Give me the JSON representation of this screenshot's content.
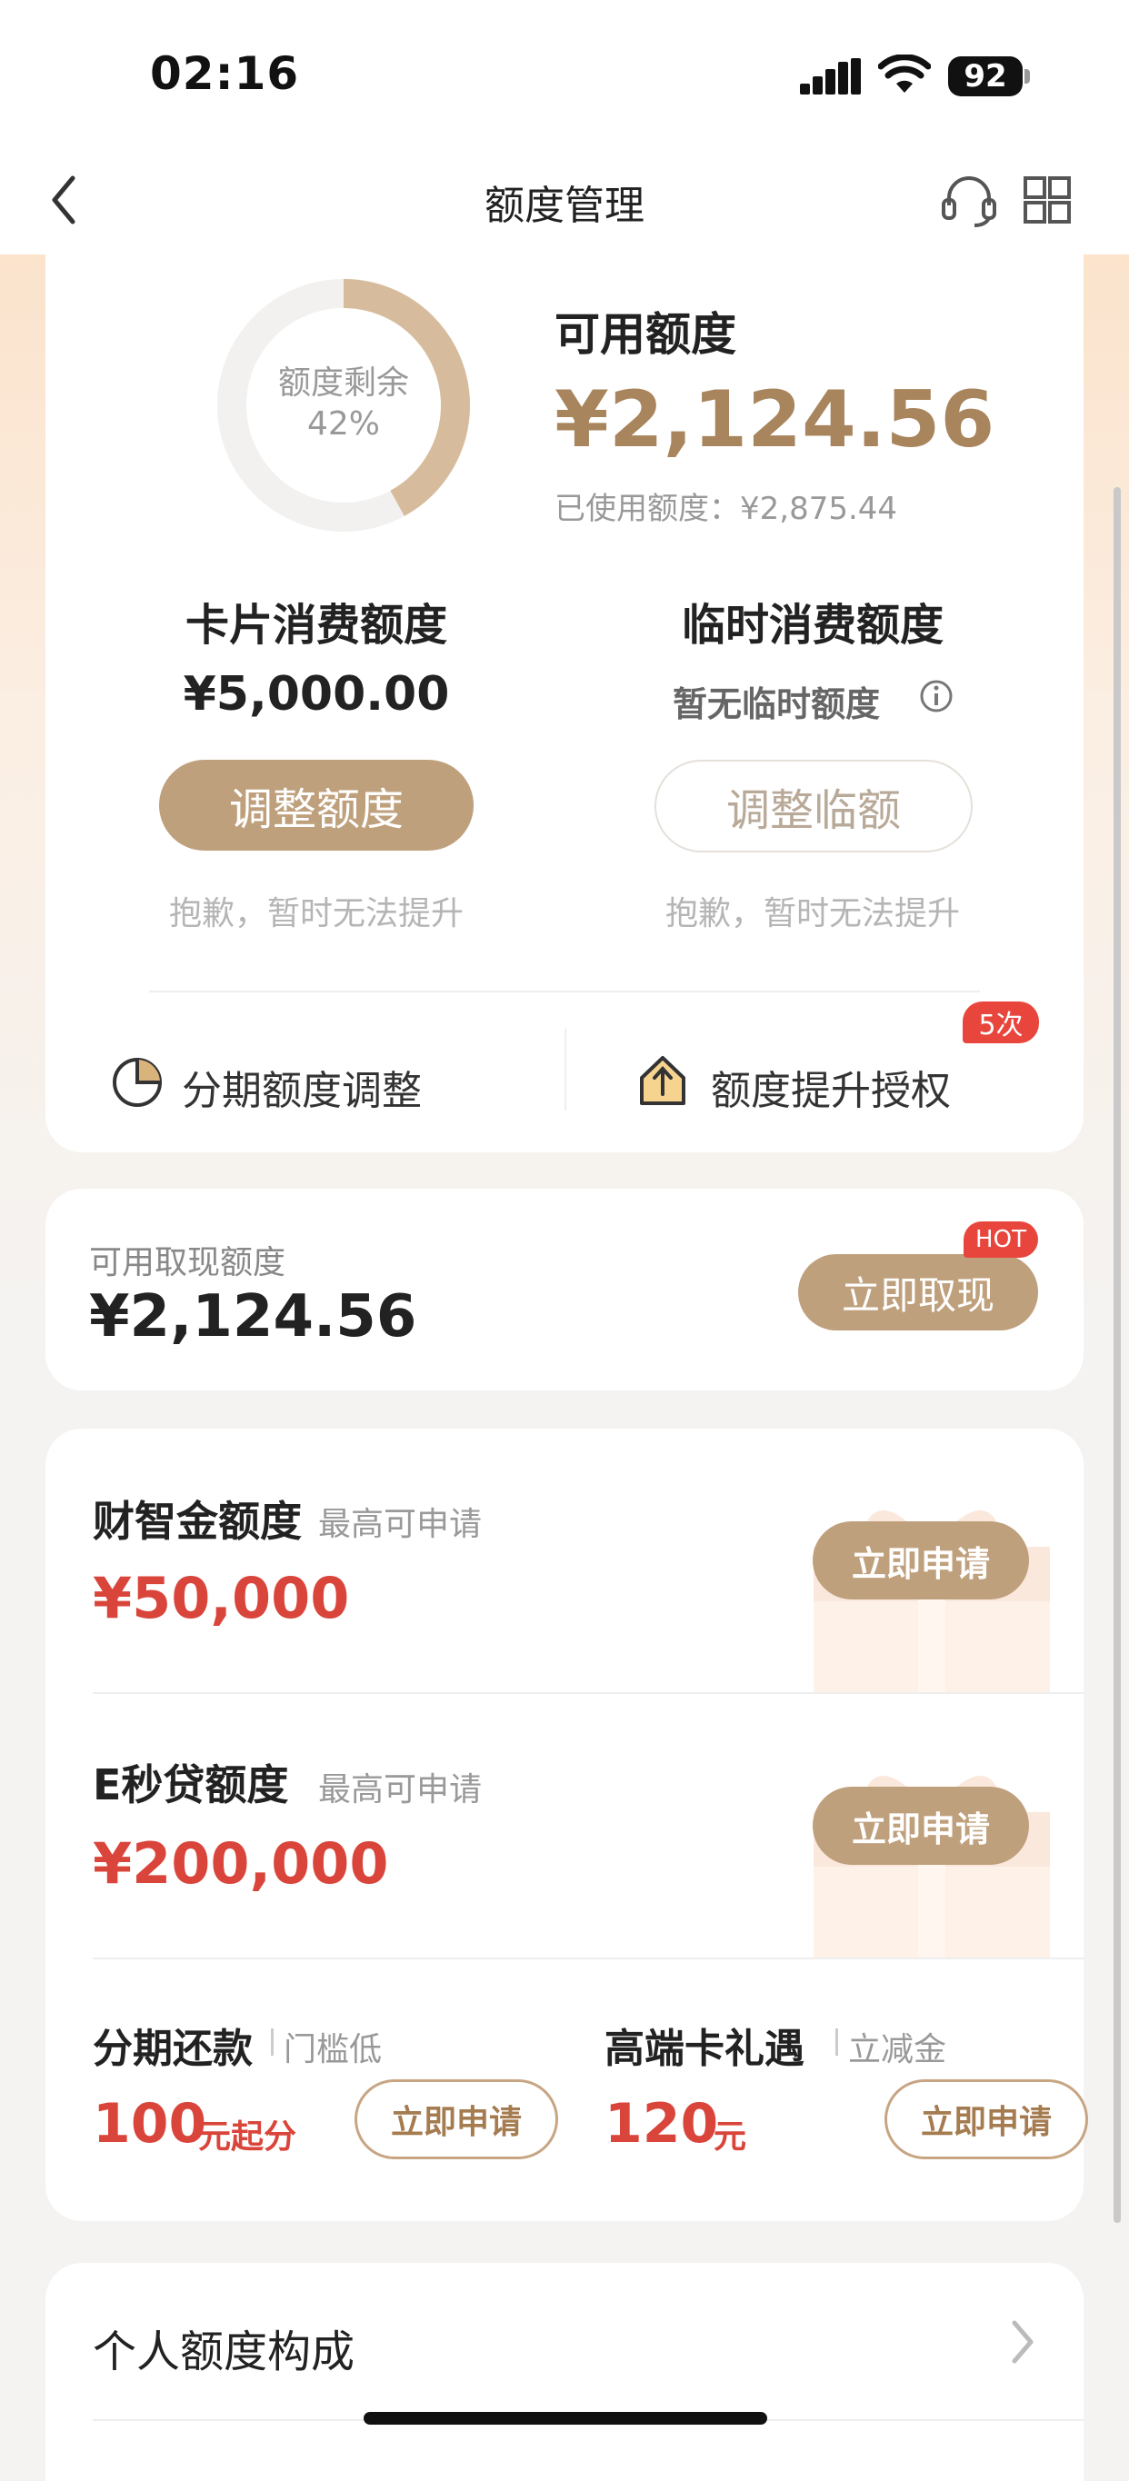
{
  "status_bar": {
    "time": "02:16",
    "battery": "92"
  },
  "nav": {
    "title": "额度管理"
  },
  "summary": {
    "ring_label": "额度剩余",
    "ring_percent": "42%",
    "ring_fraction": 0.42,
    "available_label": "可用额度",
    "available_value": "¥2,124.56",
    "used_text": "已使用额度：¥2,875.44"
  },
  "card_limit": {
    "title": "卡片消费额度",
    "value": "¥5,000.00",
    "button": "调整额度",
    "note": "抱歉，暂时无法提升"
  },
  "temp_limit": {
    "title": "临时消费额度",
    "value": "暂无临时额度",
    "button": "调整临额",
    "note": "抱歉，暂时无法提升"
  },
  "links": {
    "installment_adjust": "分期额度调整",
    "raise_auth": "额度提升授权",
    "raise_auth_badge": "5次"
  },
  "cash": {
    "label": "可用取现额度",
    "value": "¥2,124.56",
    "button": "立即取现",
    "badge": "HOT"
  },
  "offers": [
    {
      "title": "财智金额度",
      "subtitle": "最高可申请",
      "amount": "¥50,000",
      "button": "立即申请"
    },
    {
      "title": "E秒贷额度",
      "subtitle": "最高可申请",
      "amount": "¥200,000",
      "button": "立即申请"
    }
  ],
  "mini_offers": [
    {
      "title": "分期还款",
      "tag": "门槛低",
      "amount": "100",
      "unit": "元起分",
      "button": "立即申请"
    },
    {
      "title": "高端卡礼遇",
      "tag": "立减金",
      "amount": "120",
      "unit": "元",
      "button": "立即申请"
    }
  ],
  "bottom": {
    "item": "个人额度构成"
  },
  "colors": {
    "gold": "#bfa07c",
    "red": "#d9453b",
    "ring_track": "#f3f1ef"
  }
}
